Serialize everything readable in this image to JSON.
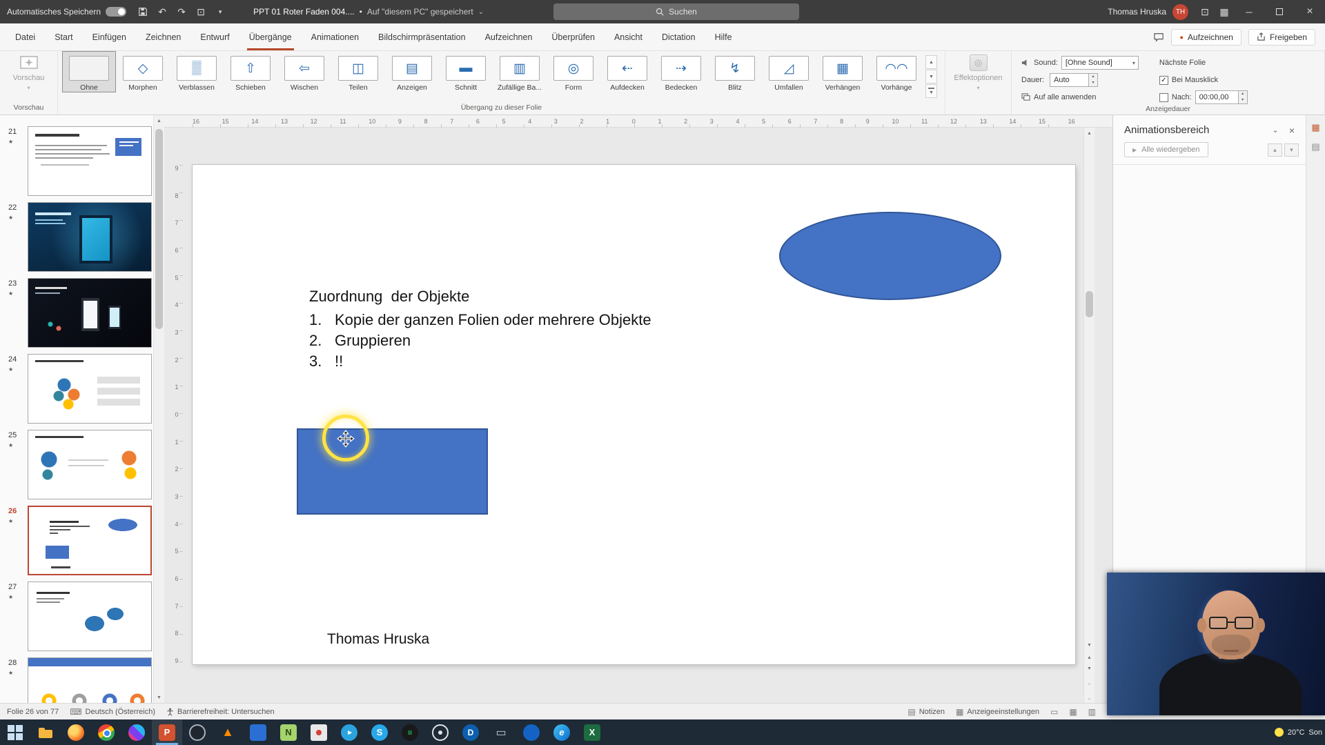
{
  "colors": {
    "accent": "#b7472a",
    "shape_fill": "#4472c4",
    "selected_slide_border": "#bc4632",
    "highlight_ring": "#ffe344",
    "taskbar_bg": "#1e2a36"
  },
  "glyphs": {
    "dropdown": "▾",
    "spin_up": "▴",
    "spin_down": "▾",
    "scroll_up": "▲",
    "scroll_down": "▼",
    "chevron_down": "⌄",
    "close": "×",
    "minimize": "─",
    "check": "✓",
    "play": "▶",
    "record_dot": "●",
    "star": "★",
    "dot_sep": "•",
    "undo": "↶",
    "redo": "↷",
    "screen": "⊡",
    "grid": "▦",
    "keyboard": "⌨",
    "notes_icon": "▤",
    "display_icon": "▦",
    "view_normal": "▭",
    "view_sorter": "▦",
    "view_show": "▥",
    "panel_grid": "▦",
    "panel_page": "▤",
    "mini_a": "▫",
    "mini_b": "▫"
  },
  "titlebar": {
    "autosave": "Automatisches Speichern",
    "doc": "PPT 01 Roter Faden 004....",
    "saved": "Auf \"diesem PC\" gespeichert",
    "search": "Suchen",
    "user": "Thomas Hruska",
    "initials": "TH"
  },
  "tabsrow": {
    "record": "Aufzeichnen",
    "share": "Freigeben"
  },
  "tabs": [
    {
      "label": "Datei"
    },
    {
      "label": "Start"
    },
    {
      "label": "Einfügen"
    },
    {
      "label": "Zeichnen"
    },
    {
      "label": "Entwurf"
    },
    {
      "label": "Übergänge",
      "cls": "active"
    },
    {
      "label": "Animationen"
    },
    {
      "label": "Bildschirmpräsentation"
    },
    {
      "label": "Aufzeichnen"
    },
    {
      "label": "Überprüfen"
    },
    {
      "label": "Ansicht"
    },
    {
      "label": "Dictation"
    },
    {
      "label": "Hilfe"
    }
  ],
  "ribbon": {
    "preview": "Vorschau",
    "preview_group": "Vorschau",
    "gallery_group": "Übergang zu dieser Folie",
    "effect_options": "Effektoptionen",
    "timing_group": "Anzeigedauer",
    "sound_label": "Sound:",
    "sound_value": "[Ohne Sound]",
    "duration_label": "Dauer:",
    "duration_value": "Auto",
    "apply_all": "Auf alle anwenden",
    "next_slide": "Nächste Folie",
    "on_click": "Bei Mausklick",
    "after_label": "Nach:",
    "after_value": "00:00,00"
  },
  "transitions": [
    {
      "label": "Ohne",
      "glyph": "",
      "cls": "selected"
    },
    {
      "label": "Morphen",
      "glyph": "◇"
    },
    {
      "label": "Verblassen",
      "glyph": "▒"
    },
    {
      "label": "Schieben",
      "glyph": "⇧"
    },
    {
      "label": "Wischen",
      "glyph": "⇦"
    },
    {
      "label": "Teilen",
      "glyph": "◫"
    },
    {
      "label": "Anzeigen",
      "glyph": "▤"
    },
    {
      "label": "Schnitt",
      "glyph": "▬"
    },
    {
      "label": "Zufällige Ba...",
      "glyph": "▥"
    },
    {
      "label": "Form",
      "glyph": "◎"
    },
    {
      "label": "Aufdecken",
      "glyph": "⇠"
    },
    {
      "label": "Bedecken",
      "glyph": "⇢"
    },
    {
      "label": "Blitz",
      "glyph": "↯"
    },
    {
      "label": "Umfallen",
      "glyph": "◿"
    },
    {
      "label": "Verhängen",
      "glyph": "▦"
    },
    {
      "label": "Vorhänge",
      "glyph": "◠◠"
    }
  ],
  "thumbs": [
    {
      "num": "21",
      "star": "★",
      "cls": "t21"
    },
    {
      "num": "22",
      "star": "★",
      "cls": "t22"
    },
    {
      "num": "23",
      "star": "★",
      "cls": "t23"
    },
    {
      "num": "24",
      "star": "★",
      "cls": "t24"
    },
    {
      "num": "25",
      "star": "★",
      "cls": "t25"
    },
    {
      "num": "26",
      "star": "★",
      "cls": "t26 selected"
    },
    {
      "num": "27",
      "star": "★",
      "cls": "t27"
    },
    {
      "num": "28",
      "star": "★",
      "cls": "t28"
    }
  ],
  "ruler_h": [
    "16",
    "15",
    "14",
    "13",
    "12",
    "11",
    "10",
    "9",
    "8",
    "7",
    "6",
    "5",
    "4",
    "3",
    "2",
    "1",
    "0",
    "1",
    "2",
    "3",
    "4",
    "5",
    "6",
    "7",
    "8",
    "9",
    "10",
    "11",
    "12",
    "13",
    "14",
    "15",
    "16"
  ],
  "ruler_v": [
    "9",
    "8",
    "7",
    "6",
    "5",
    "4",
    "3",
    "2",
    "1",
    "0",
    "1",
    "2",
    "3",
    "4",
    "5",
    "6",
    "7",
    "8",
    "9"
  ],
  "slide": {
    "title": "Zuordnung  der Objekte",
    "items": [
      {
        "n": "1.",
        "text": "Kopie der ganzen Folien oder mehrere Objekte"
      },
      {
        "n": "2.",
        "text": "Gruppieren"
      },
      {
        "n": "3.",
        "text": "!!"
      }
    ],
    "footer": "Thomas Hruska"
  },
  "pane": {
    "title": "Animationsbereich",
    "play": "Alle wiedergeben"
  },
  "status": {
    "slide": "Folie 26 von 77",
    "lang": "Deutsch (Österreich)",
    "access": "Barrierefreiheit: Untersuchen",
    "notes": "Notizen",
    "display": "Anzeigeeinstellungen"
  },
  "taskbar": {
    "weather_temp": "20°C",
    "weather_cond": "Son",
    "icons": [
      {
        "name": "start",
        "cls": "i-start",
        "glyph": ""
      },
      {
        "name": "file-explorer",
        "cls": "i-folder",
        "glyph": ""
      },
      {
        "name": "firefox",
        "cls": "i-firefox",
        "glyph": ""
      },
      {
        "name": "chrome",
        "cls": "i-chrome",
        "glyph": ""
      },
      {
        "name": "media-app",
        "cls": "i-pinwheel",
        "glyph": ""
      },
      {
        "name": "powerpoint",
        "cls": "i-ppt active",
        "glyph": "P"
      },
      {
        "name": "obs",
        "cls": "i-obs",
        "glyph": ""
      },
      {
        "name": "vlc",
        "cls": "i-vlc",
        "glyph": "▲"
      },
      {
        "name": "blue-app",
        "cls": "i-blueapp",
        "glyph": ""
      },
      {
        "name": "notepad-plus",
        "cls": "i-npp",
        "glyph": "N"
      },
      {
        "name": "photo-viewer",
        "cls": "i-photo",
        "glyph": ""
      },
      {
        "name": "telegram",
        "cls": "i-telegram",
        "glyph": "▸"
      },
      {
        "name": "skype",
        "cls": "i-skype",
        "glyph": "S"
      },
      {
        "name": "spotify",
        "cls": "i-spotify",
        "glyph": "≡"
      },
      {
        "name": "screen-recorder",
        "cls": "i-record",
        "glyph": ""
      },
      {
        "name": "docs-app",
        "cls": "i-disc",
        "glyph": "D"
      },
      {
        "name": "display-app",
        "cls": "i-monitor",
        "glyph": "▭"
      },
      {
        "name": "messenger-app",
        "cls": "i-bluedot",
        "glyph": ""
      },
      {
        "name": "edge",
        "cls": "i-edge",
        "glyph": "e"
      },
      {
        "name": "excel",
        "cls": "i-excel",
        "glyph": "X"
      }
    ]
  }
}
